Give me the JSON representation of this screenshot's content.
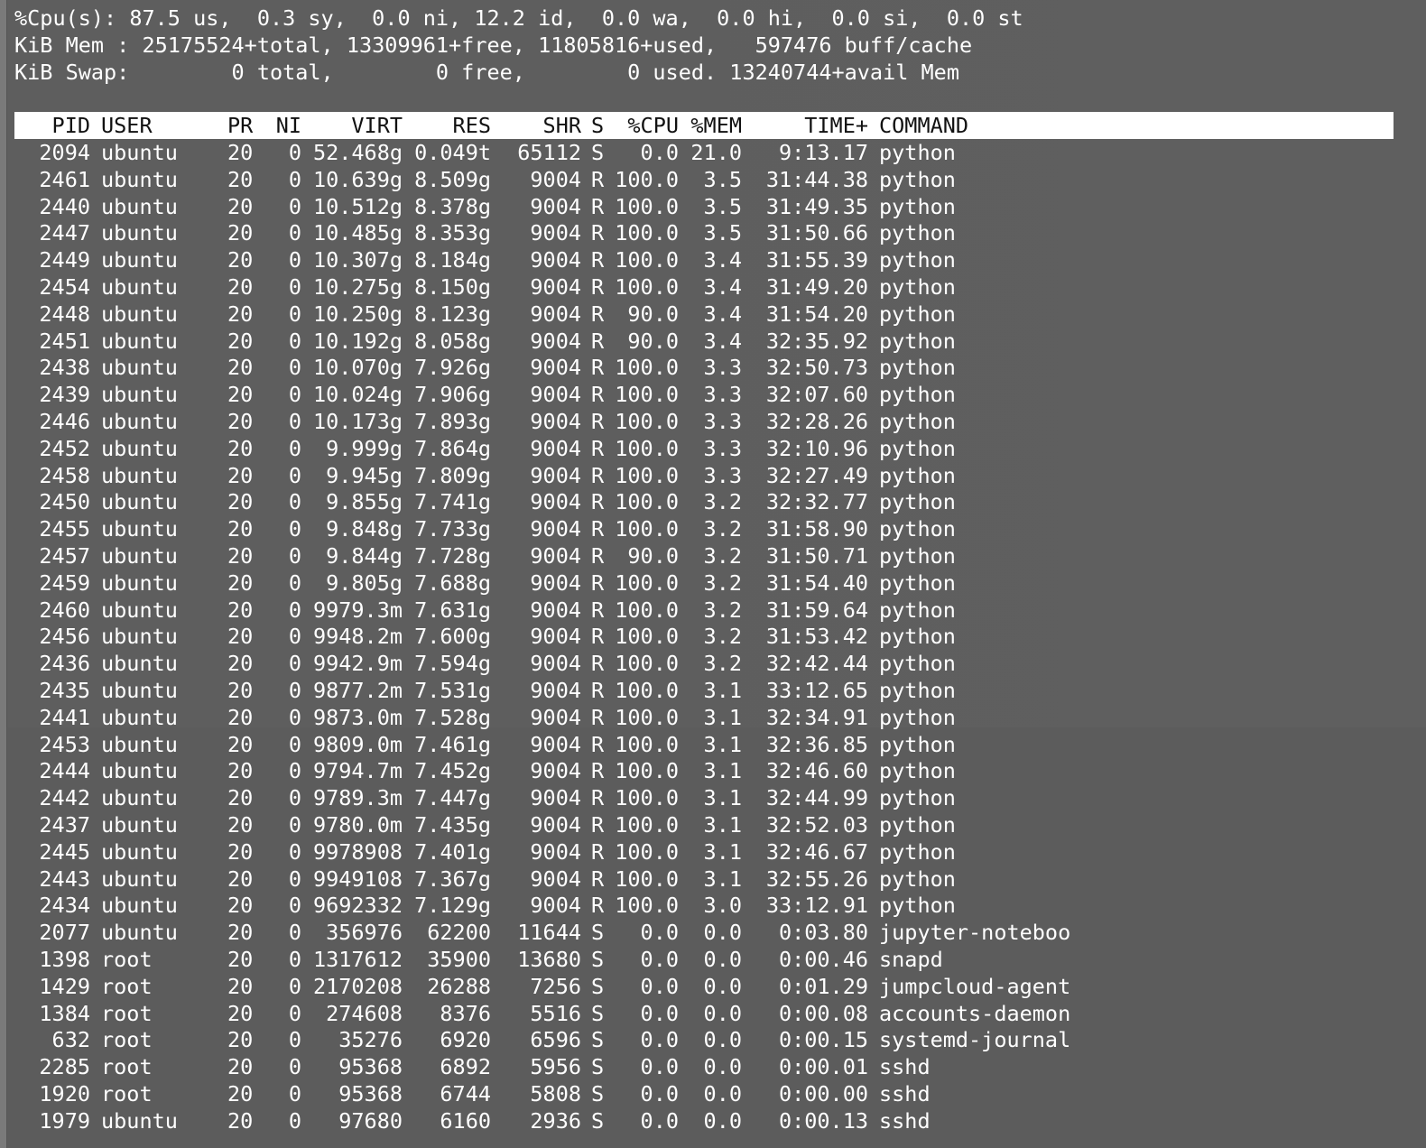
{
  "summary": {
    "cpu_line": "%Cpu(s): 87.5 us,  0.3 sy,  0.0 ni, 12.2 id,  0.0 wa,  0.0 hi,  0.0 si,  0.0 st",
    "mem_line": "KiB Mem : 25175524+total, 13309961+free, 11805816+used,   597476 buff/cache",
    "swap_line": "KiB Swap:        0 total,        0 free,        0 used. 13240744+avail Mem"
  },
  "columns": [
    "PID",
    "USER",
    "PR",
    "NI",
    "VIRT",
    "RES",
    "SHR",
    "S",
    "%CPU",
    "%MEM",
    "TIME+",
    "COMMAND"
  ],
  "processes": [
    [
      "2094",
      "ubuntu",
      "20",
      "0",
      "52.468g",
      "0.049t",
      "65112",
      "S",
      "0.0",
      "21.0",
      "9:13.17",
      "python"
    ],
    [
      "2461",
      "ubuntu",
      "20",
      "0",
      "10.639g",
      "8.509g",
      "9004",
      "R",
      "100.0",
      "3.5",
      "31:44.38",
      "python"
    ],
    [
      "2440",
      "ubuntu",
      "20",
      "0",
      "10.512g",
      "8.378g",
      "9004",
      "R",
      "100.0",
      "3.5",
      "31:49.35",
      "python"
    ],
    [
      "2447",
      "ubuntu",
      "20",
      "0",
      "10.485g",
      "8.353g",
      "9004",
      "R",
      "100.0",
      "3.5",
      "31:50.66",
      "python"
    ],
    [
      "2449",
      "ubuntu",
      "20",
      "0",
      "10.307g",
      "8.184g",
      "9004",
      "R",
      "100.0",
      "3.4",
      "31:55.39",
      "python"
    ],
    [
      "2454",
      "ubuntu",
      "20",
      "0",
      "10.275g",
      "8.150g",
      "9004",
      "R",
      "100.0",
      "3.4",
      "31:49.20",
      "python"
    ],
    [
      "2448",
      "ubuntu",
      "20",
      "0",
      "10.250g",
      "8.123g",
      "9004",
      "R",
      "90.0",
      "3.4",
      "31:54.20",
      "python"
    ],
    [
      "2451",
      "ubuntu",
      "20",
      "0",
      "10.192g",
      "8.058g",
      "9004",
      "R",
      "90.0",
      "3.4",
      "32:35.92",
      "python"
    ],
    [
      "2438",
      "ubuntu",
      "20",
      "0",
      "10.070g",
      "7.926g",
      "9004",
      "R",
      "100.0",
      "3.3",
      "32:50.73",
      "python"
    ],
    [
      "2439",
      "ubuntu",
      "20",
      "0",
      "10.024g",
      "7.906g",
      "9004",
      "R",
      "100.0",
      "3.3",
      "32:07.60",
      "python"
    ],
    [
      "2446",
      "ubuntu",
      "20",
      "0",
      "10.173g",
      "7.893g",
      "9004",
      "R",
      "100.0",
      "3.3",
      "32:28.26",
      "python"
    ],
    [
      "2452",
      "ubuntu",
      "20",
      "0",
      "9.999g",
      "7.864g",
      "9004",
      "R",
      "100.0",
      "3.3",
      "32:10.96",
      "python"
    ],
    [
      "2458",
      "ubuntu",
      "20",
      "0",
      "9.945g",
      "7.809g",
      "9004",
      "R",
      "100.0",
      "3.3",
      "32:27.49",
      "python"
    ],
    [
      "2450",
      "ubuntu",
      "20",
      "0",
      "9.855g",
      "7.741g",
      "9004",
      "R",
      "100.0",
      "3.2",
      "32:32.77",
      "python"
    ],
    [
      "2455",
      "ubuntu",
      "20",
      "0",
      "9.848g",
      "7.733g",
      "9004",
      "R",
      "100.0",
      "3.2",
      "31:58.90",
      "python"
    ],
    [
      "2457",
      "ubuntu",
      "20",
      "0",
      "9.844g",
      "7.728g",
      "9004",
      "R",
      "90.0",
      "3.2",
      "31:50.71",
      "python"
    ],
    [
      "2459",
      "ubuntu",
      "20",
      "0",
      "9.805g",
      "7.688g",
      "9004",
      "R",
      "100.0",
      "3.2",
      "31:54.40",
      "python"
    ],
    [
      "2460",
      "ubuntu",
      "20",
      "0",
      "9979.3m",
      "7.631g",
      "9004",
      "R",
      "100.0",
      "3.2",
      "31:59.64",
      "python"
    ],
    [
      "2456",
      "ubuntu",
      "20",
      "0",
      "9948.2m",
      "7.600g",
      "9004",
      "R",
      "100.0",
      "3.2",
      "31:53.42",
      "python"
    ],
    [
      "2436",
      "ubuntu",
      "20",
      "0",
      "9942.9m",
      "7.594g",
      "9004",
      "R",
      "100.0",
      "3.2",
      "32:42.44",
      "python"
    ],
    [
      "2435",
      "ubuntu",
      "20",
      "0",
      "9877.2m",
      "7.531g",
      "9004",
      "R",
      "100.0",
      "3.1",
      "33:12.65",
      "python"
    ],
    [
      "2441",
      "ubuntu",
      "20",
      "0",
      "9873.0m",
      "7.528g",
      "9004",
      "R",
      "100.0",
      "3.1",
      "32:34.91",
      "python"
    ],
    [
      "2453",
      "ubuntu",
      "20",
      "0",
      "9809.0m",
      "7.461g",
      "9004",
      "R",
      "100.0",
      "3.1",
      "32:36.85",
      "python"
    ],
    [
      "2444",
      "ubuntu",
      "20",
      "0",
      "9794.7m",
      "7.452g",
      "9004",
      "R",
      "100.0",
      "3.1",
      "32:46.60",
      "python"
    ],
    [
      "2442",
      "ubuntu",
      "20",
      "0",
      "9789.3m",
      "7.447g",
      "9004",
      "R",
      "100.0",
      "3.1",
      "32:44.99",
      "python"
    ],
    [
      "2437",
      "ubuntu",
      "20",
      "0",
      "9780.0m",
      "7.435g",
      "9004",
      "R",
      "100.0",
      "3.1",
      "32:52.03",
      "python"
    ],
    [
      "2445",
      "ubuntu",
      "20",
      "0",
      "9978908",
      "7.401g",
      "9004",
      "R",
      "100.0",
      "3.1",
      "32:46.67",
      "python"
    ],
    [
      "2443",
      "ubuntu",
      "20",
      "0",
      "9949108",
      "7.367g",
      "9004",
      "R",
      "100.0",
      "3.1",
      "32:55.26",
      "python"
    ],
    [
      "2434",
      "ubuntu",
      "20",
      "0",
      "9692332",
      "7.129g",
      "9004",
      "R",
      "100.0",
      "3.0",
      "33:12.91",
      "python"
    ],
    [
      "2077",
      "ubuntu",
      "20",
      "0",
      "356976",
      "62200",
      "11644",
      "S",
      "0.0",
      "0.0",
      "0:03.80",
      "jupyter-noteboo"
    ],
    [
      "1398",
      "root",
      "20",
      "0",
      "1317612",
      "35900",
      "13680",
      "S",
      "0.0",
      "0.0",
      "0:00.46",
      "snapd"
    ],
    [
      "1429",
      "root",
      "20",
      "0",
      "2170208",
      "26288",
      "7256",
      "S",
      "0.0",
      "0.0",
      "0:01.29",
      "jumpcloud-agent"
    ],
    [
      "1384",
      "root",
      "20",
      "0",
      "274608",
      "8376",
      "5516",
      "S",
      "0.0",
      "0.0",
      "0:00.08",
      "accounts-daemon"
    ],
    [
      "632",
      "root",
      "20",
      "0",
      "35276",
      "6920",
      "6596",
      "S",
      "0.0",
      "0.0",
      "0:00.15",
      "systemd-journal"
    ],
    [
      "2285",
      "root",
      "20",
      "0",
      "95368",
      "6892",
      "5956",
      "S",
      "0.0",
      "0.0",
      "0:00.01",
      "sshd"
    ],
    [
      "1920",
      "root",
      "20",
      "0",
      "95368",
      "6744",
      "5808",
      "S",
      "0.0",
      "0.0",
      "0:00.00",
      "sshd"
    ],
    [
      "1979",
      "ubuntu",
      "20",
      "0",
      "97680",
      "6160",
      "2936",
      "S",
      "0.0",
      "0.0",
      "0:00.13",
      "sshd"
    ]
  ]
}
